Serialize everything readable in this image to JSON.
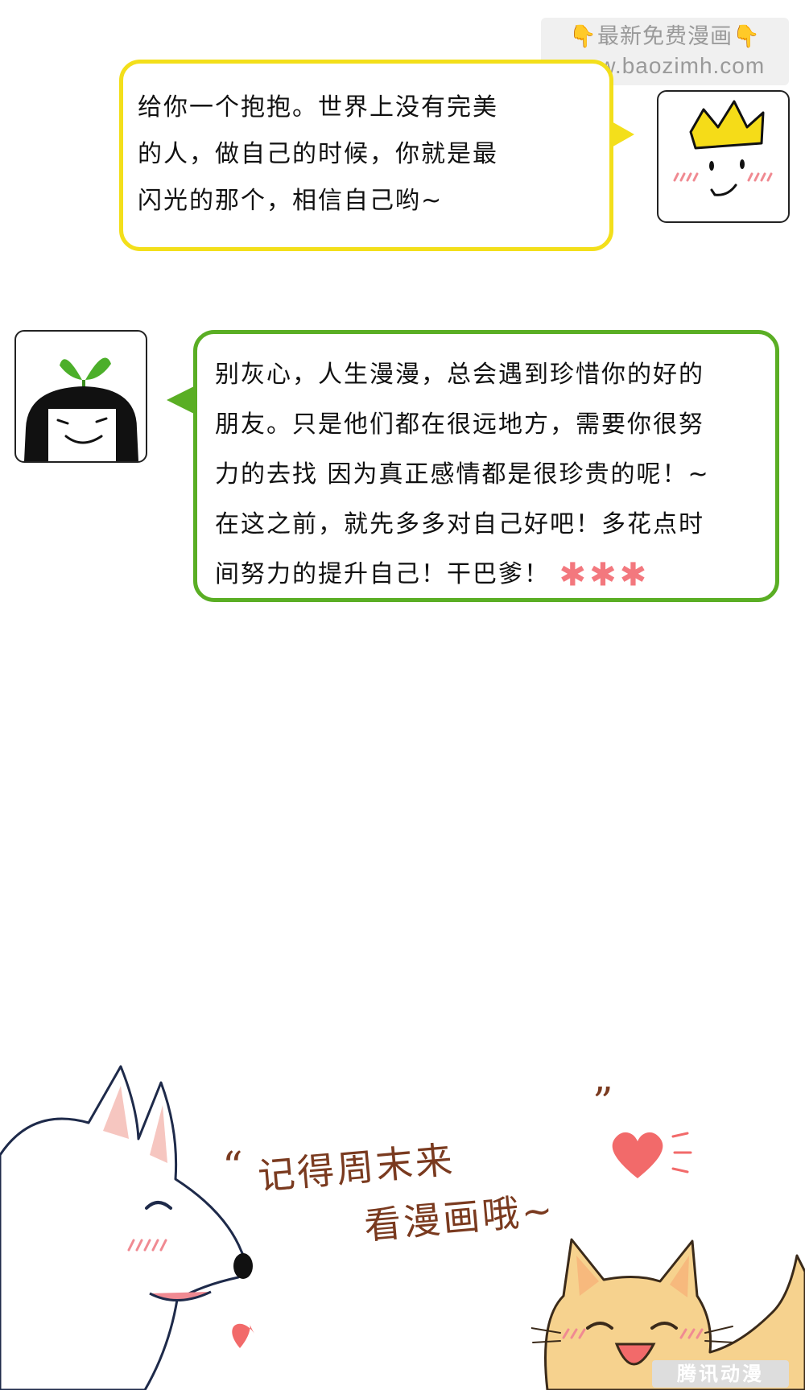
{
  "watermark": {
    "line1": "👇最新免费漫画👇",
    "line2": "www.baozimh.com"
  },
  "yellow_bubble": {
    "lines": [
      "给你一个抱抱。世界上没有完美",
      "的人，做自己的时候，你就是最",
      "闪光的那个，相信自己哟~"
    ],
    "border_color": "#f3df1b"
  },
  "green_bubble": {
    "lines": [
      "别灰心，人生漫漫，总会遇到珍惜你的好的",
      "朋友。只是他们都在很远地方，需要你很努",
      "力的去找  因为真正感情都是很珍贵的呢！~",
      "在这之前，就先多多对自己好吧！多花点时",
      "间努力的提升自己！干巴爹！"
    ],
    "stars": "✱✱✱",
    "border_color": "#5aae24"
  },
  "signoff": {
    "line1": "记得周末来",
    "line2": "看漫画哦~",
    "open_quote": "“",
    "close_quote": "”",
    "color": "#7a3a1f"
  },
  "brand_logo": "腾讯动漫",
  "icons": [
    "king-crown-avatar",
    "sprout-girl-avatar",
    "white-dog-illustration",
    "orange-cat-illustration",
    "heart-icon"
  ]
}
